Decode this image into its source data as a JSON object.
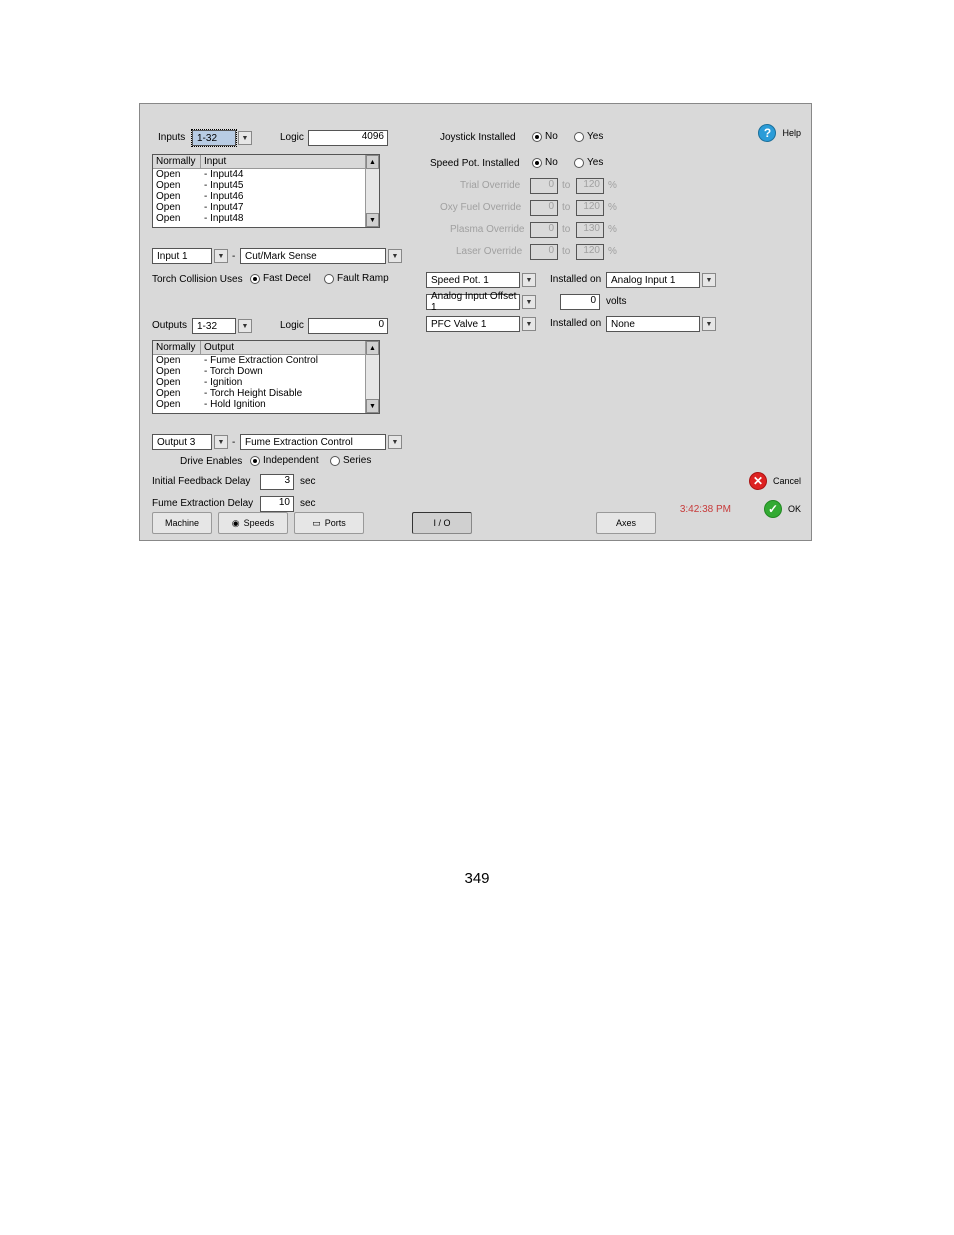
{
  "page_number": "349",
  "clock": "3:42:38 PM",
  "left": {
    "inputs_label": "Inputs",
    "inputs_range": "1-32",
    "inputs_logic_label": "Logic",
    "inputs_logic_value": "4096",
    "inputs_list_hdr1": "Normally",
    "inputs_list_hdr2": "Input",
    "inputs_list": [
      {
        "state": "Open",
        "name": "- Input44"
      },
      {
        "state": "Open",
        "name": "- Input45"
      },
      {
        "state": "Open",
        "name": "- Input46"
      },
      {
        "state": "Open",
        "name": "- Input47"
      },
      {
        "state": "Open",
        "name": "- Input48"
      }
    ],
    "input_sel_label": "Input 1",
    "input_sel_map": "Cut/Mark Sense",
    "torch_collision_label": "Torch Collision Uses",
    "torch_collision_opt1": "Fast Decel",
    "torch_collision_opt2": "Fault Ramp",
    "outputs_label": "Outputs",
    "outputs_range": "1-32",
    "outputs_logic_label": "Logic",
    "outputs_logic_value": "0",
    "outputs_list_hdr1": "Normally",
    "outputs_list_hdr2": "Output",
    "outputs_list": [
      {
        "state": "Open",
        "name": "- Fume Extraction Control"
      },
      {
        "state": "Open",
        "name": "- Torch Down"
      },
      {
        "state": "Open",
        "name": "- Ignition"
      },
      {
        "state": "Open",
        "name": "- Torch Height Disable"
      },
      {
        "state": "Open",
        "name": "- Hold Ignition"
      }
    ],
    "output_sel_label": "Output 3",
    "output_sel_map": "Fume Extraction Control",
    "drive_enables_label": "Drive Enables",
    "drive_enables_opt1": "Independent",
    "drive_enables_opt2": "Series",
    "ifd_label": "Initial Feedback Delay",
    "ifd_value": "3",
    "ifd_unit": "sec",
    "fed_label": "Fume Extraction Delay",
    "fed_value": "10",
    "fed_unit": "sec"
  },
  "right": {
    "joystick_label": "Joystick Installed",
    "no": "No",
    "yes": "Yes",
    "speedpot_inst_label": "Speed Pot. Installed",
    "trial_label": "Trial Override",
    "trial_from": "0",
    "trial_to": "120",
    "oxy_label": "Oxy Fuel Override",
    "oxy_from": "0",
    "oxy_to": "120",
    "plasma_label": "Plasma Override",
    "plasma_from": "0",
    "plasma_to": "130",
    "laser_label": "Laser Override",
    "laser_from": "0",
    "laser_to": "120",
    "to_word": "to",
    "pct": "%",
    "speedpot_combo": "Speed Pot. 1",
    "installed_on_label": "Installed on",
    "installed_on_val": "Analog Input 1",
    "analog_offset_label": "Analog Input Offset 1",
    "analog_offset_val": "0",
    "analog_offset_unit": "volts",
    "pfc_label": "PFC Valve 1",
    "pfc_installed_on": "Installed on",
    "pfc_val": "None"
  },
  "buttons": {
    "help": "Help",
    "cancel": "Cancel",
    "ok": "OK",
    "machine": "Machine",
    "speeds": "Speeds",
    "ports": "Ports",
    "io": "I / O",
    "axes": "Axes"
  }
}
